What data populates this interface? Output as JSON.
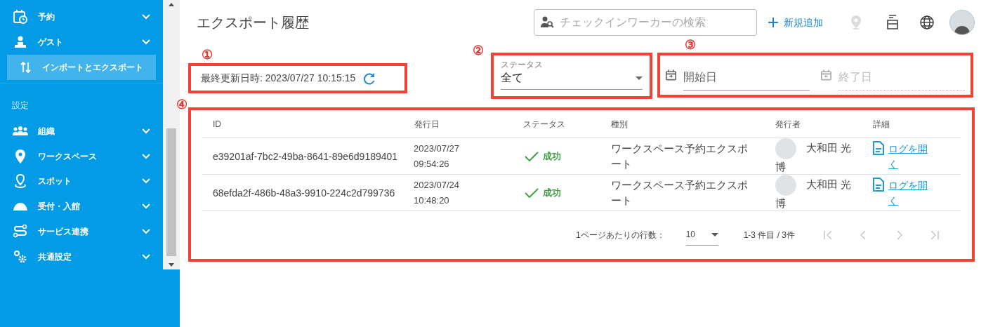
{
  "sidebar": {
    "items": [
      {
        "label": "予約",
        "kind": "group",
        "selected": false
      },
      {
        "label": "ゲスト",
        "kind": "group",
        "selected": false
      },
      {
        "label": "インポートとエクスポート",
        "kind": "link",
        "selected": true
      },
      {
        "label": "設定",
        "kind": "section"
      },
      {
        "label": "組織",
        "kind": "group",
        "selected": false
      },
      {
        "label": "ワークスペース",
        "kind": "group",
        "selected": false
      },
      {
        "label": "スポット",
        "kind": "group",
        "selected": false
      },
      {
        "label": "受付・入館",
        "kind": "group",
        "selected": false
      },
      {
        "label": "サービス連携",
        "kind": "group",
        "selected": false
      },
      {
        "label": "共通設定",
        "kind": "group",
        "selected": false
      }
    ]
  },
  "header": {
    "title": "エクスポート履歴",
    "search": {
      "placeholder": "チェックインワーカーの検索"
    },
    "add_button": "新規追加"
  },
  "annotations": [
    "①",
    "②",
    "③",
    "④"
  ],
  "last_updated": "最終更新日時: 2023/07/27 10:15:15",
  "status_filter": {
    "label": "ステータス",
    "value": "全て"
  },
  "date_range": {
    "start_placeholder": "開始日",
    "end_placeholder": "終了日"
  },
  "table": {
    "columns": [
      "ID",
      "発行日",
      "ステータス",
      "種別",
      "発行者",
      "詳細"
    ],
    "rows": [
      {
        "id": "e39201af-7bc2-49ba-8641-89e6d9189401",
        "date": "2023/07/27 09:54:26",
        "status": "成功",
        "type": "ワークスペース予約エクスポート",
        "issuer": "大和田 光博",
        "detail": "ログを開く"
      },
      {
        "id": "68efda2f-486b-48a3-9910-224c2d799736",
        "date": "2023/07/24 10:48:20",
        "status": "成功",
        "type": "ワークスペース予約エクスポート",
        "issuer": "大和田 光博",
        "detail": "ログを開く"
      }
    ]
  },
  "pagination": {
    "rows_per_page_label": "1ページあたりの行数：",
    "rows_per_page": "10",
    "range": "1-3 件目 / 3件",
    "buttons": [
      {
        "kind": "first",
        "disabled": true
      },
      {
        "kind": "prev",
        "disabled": true
      },
      {
        "kind": "next",
        "disabled": true
      },
      {
        "kind": "last",
        "disabled": true
      }
    ]
  }
}
